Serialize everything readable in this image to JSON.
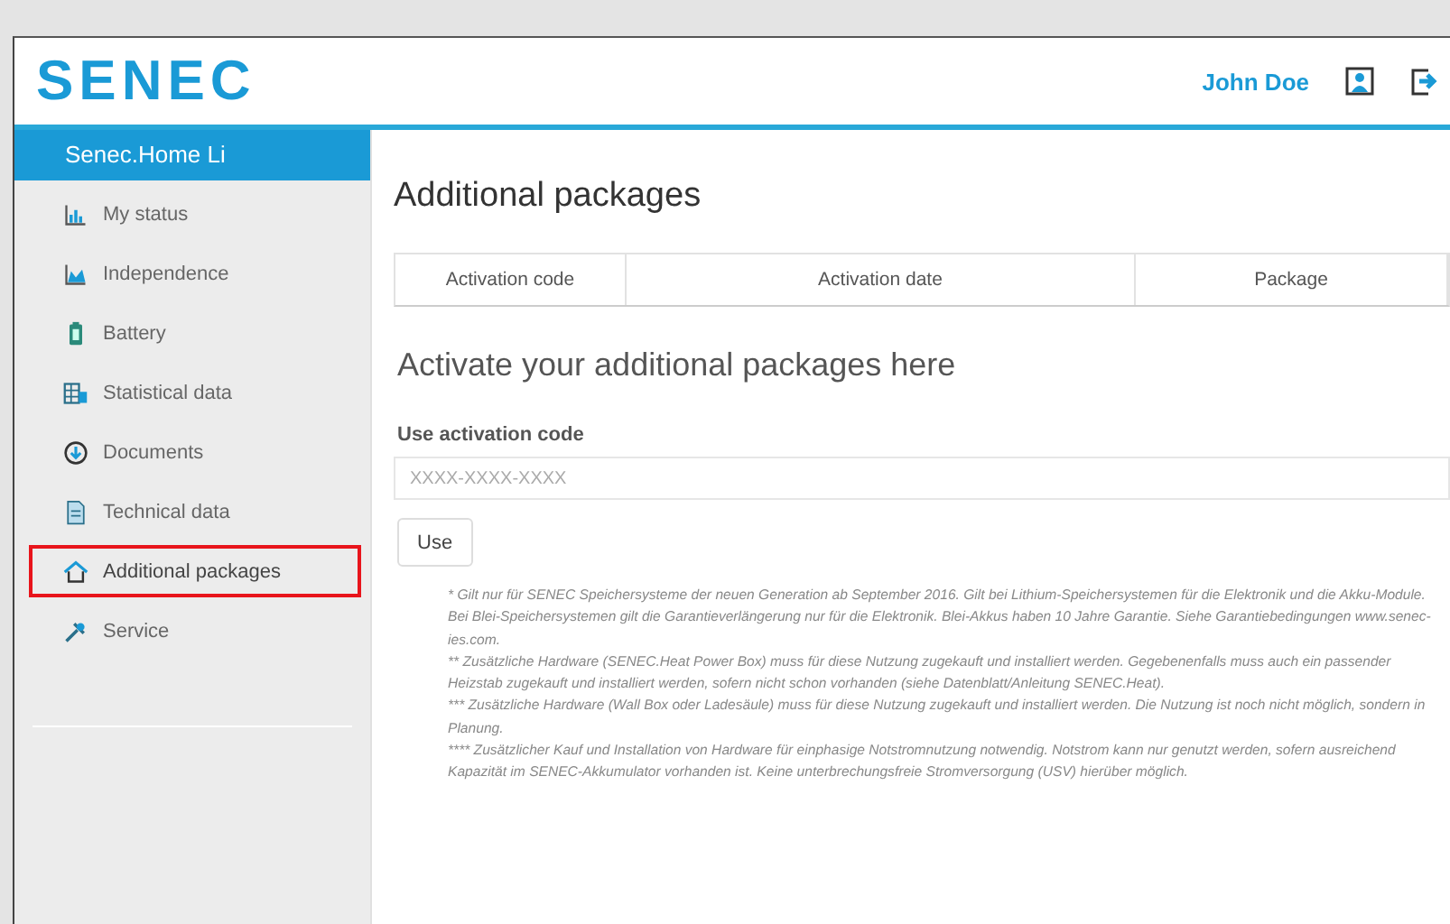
{
  "header": {
    "logo": "SENEC",
    "user": "John Doe"
  },
  "sidebar": {
    "system": "Senec.Home Li",
    "items": [
      {
        "label": "My status",
        "kind": "chart",
        "selected": false
      },
      {
        "label": "Independence",
        "kind": "area",
        "selected": false
      },
      {
        "label": "Battery",
        "kind": "battery",
        "selected": false
      },
      {
        "label": "Statistical data",
        "kind": "stats",
        "selected": false
      },
      {
        "label": "Documents",
        "kind": "download",
        "selected": false
      },
      {
        "label": "Technical data",
        "kind": "doc",
        "selected": false
      },
      {
        "label": "Additional packages",
        "kind": "home",
        "selected": true
      },
      {
        "label": "Service",
        "kind": "tools",
        "selected": false
      }
    ]
  },
  "main": {
    "title": "Additional packages",
    "table": {
      "columns": [
        "Activation code",
        "Activation date",
        "Package"
      ]
    },
    "activate_heading": "Activate your additional packages here",
    "field": {
      "label": "Use activation code",
      "placeholder": "XXXX-XXXX-XXXX"
    },
    "button": "Use",
    "footnotes": [
      "* Gilt nur für SENEC Speichersysteme der neuen Generation ab September 2016. Gilt bei Lithium-Speichersystemen für die Elektronik und die Akku-Module. Bei Blei-Speichersystemen gilt die Garantieverlängerung nur für die Elektronik. Blei-Akkus haben 10 Jahre Garantie. Siehe Garantiebedingungen www.senec-ies.com.",
      "** Zusätzliche Hardware (SENEC.Heat Power Box) muss für diese Nutzung zugekauft und installiert werden. Gegebenenfalls muss auch ein passender Heizstab zugekauft und installiert werden, sofern nicht schon vorhanden (siehe Datenblatt/Anleitung SENEC.Heat).",
      "*** Zusätzliche Hardware (Wall Box oder Ladesäule) muss für diese Nutzung zugekauft und installiert werden. Die Nutzung ist noch nicht möglich, sondern in Planung.",
      "**** Zusätzlicher Kauf und Installation von Hardware für einphasige Notstromnutzung notwendig. Notstrom kann nur genutzt werden, sofern ausreichend Kapazität im SENEC-Akkumulator vorhanden ist. Keine unterbrechungsfreie Stromversorgung (USV) hierüber möglich."
    ]
  }
}
